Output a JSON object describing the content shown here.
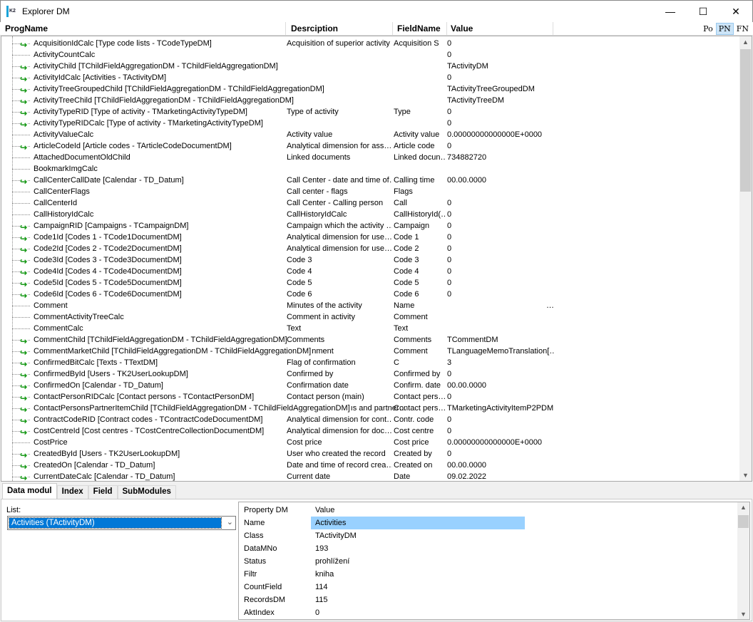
{
  "window": {
    "title": "Explorer DM",
    "minimize": "—",
    "maximize": "☐",
    "close": "✕"
  },
  "columns": {
    "progname": "ProgName",
    "description": "Desrciption",
    "fieldname": "FieldName",
    "value": "Value"
  },
  "view_modes": [
    {
      "label": "Po",
      "active": false
    },
    {
      "label": "PN",
      "active": true
    },
    {
      "label": "FN",
      "active": false
    }
  ],
  "rows": [
    {
      "prog": "AcquisitionIdCalc [Type code lists - TCodeTypeDM]",
      "desc": "Acquisition of superior activity",
      "field": "Acquisition S",
      "value": "0",
      "link": true
    },
    {
      "prog": "ActivityCountCalc",
      "desc": "",
      "field": "",
      "value": "0",
      "link": false
    },
    {
      "prog": "ActivityChild [TChildFieldAggregationDM - TChildFieldAggregationDM]",
      "desc": "",
      "field": "",
      "value": "TActivityDM",
      "link": true
    },
    {
      "prog": "ActivityIdCalc [Activities - TActivityDM]",
      "desc": "",
      "field": "",
      "value": "0",
      "link": true
    },
    {
      "prog": "ActivityTreeGroupedChild [TChildFieldAggregationDM - TChildFieldAggregationDM]",
      "desc": "",
      "field": "",
      "value": "TActivityTreeGroupedDM",
      "link": true
    },
    {
      "prog": "ActivityTreeChild [TChildFieldAggregationDM - TChildFieldAggregationDM]",
      "desc": "",
      "field": "",
      "value": "TActivityTreeDM",
      "link": true
    },
    {
      "prog": "ActivityTypeRID [Type of activity - TMarketingActivityTypeDM]",
      "desc": "Type of activity",
      "field": "Type",
      "value": "0",
      "link": true
    },
    {
      "prog": "ActivityTypeRIDCalc [Type of activity - TMarketingActivityTypeDM]",
      "desc": "",
      "field": "",
      "value": "0",
      "link": true
    },
    {
      "prog": "ActivityValueCalc",
      "desc": "Activity value",
      "field": "Activity value",
      "value": " 0.00000000000000E+0000",
      "link": false
    },
    {
      "prog": "ArticleCodeId [Article codes - TArticleCodeDocumentDM]",
      "desc": "Analytical dimension for ass…",
      "field": "Article code",
      "value": "0",
      "link": true
    },
    {
      "prog": "AttachedDocumentOldChild",
      "desc": "Linked documents",
      "field": "Linked docun…",
      "value": "734882720",
      "link": false
    },
    {
      "prog": "BookmarkImgCalc",
      "desc": "",
      "field": "",
      "value": "",
      "link": false
    },
    {
      "prog": "CallCenterCallDate [Calendar - TD_Datum]",
      "desc": "Call Center - date and time of…",
      "field": "Calling time",
      "value": "00.00.0000",
      "link": true
    },
    {
      "prog": "CallCenterFlags",
      "desc": "Call center - flags",
      "field": "Flags",
      "value": "",
      "link": false
    },
    {
      "prog": "CallCenterId",
      "desc": "Call Center - Calling person",
      "field": "Call",
      "value": "0",
      "link": false
    },
    {
      "prog": "CallHistoryIdCalc",
      "desc": "CallHistoryIdCalc",
      "field": "CallHistoryId(…",
      "value": "0",
      "link": false
    },
    {
      "prog": "CampaignRID [Campaigns - TCampaignDM]",
      "desc": "Campaign which the activity …",
      "field": "Campaign",
      "value": "0",
      "link": true
    },
    {
      "prog": "Code1Id [Codes 1 - TCode1DocumentDM]",
      "desc": "Analytical dimension for use…",
      "field": "Code 1",
      "value": "0",
      "link": true
    },
    {
      "prog": "Code2Id [Codes 2 - TCode2DocumentDM]",
      "desc": "Analytical dimension for use…",
      "field": "Code 2",
      "value": "0",
      "link": true
    },
    {
      "prog": "Code3Id [Codes 3 - TCode3DocumentDM]",
      "desc": "Code 3",
      "field": "Code 3",
      "value": "0",
      "link": true
    },
    {
      "prog": "Code4Id [Codes 4 - TCode4DocumentDM]",
      "desc": "Code 4",
      "field": "Code 4",
      "value": "0",
      "link": true
    },
    {
      "prog": "Code5Id [Codes 5 - TCode5DocumentDM]",
      "desc": "Code 5",
      "field": "Code 5",
      "value": "0",
      "link": true
    },
    {
      "prog": "Code6Id [Codes 6 - TCode6DocumentDM]",
      "desc": "Code 6",
      "field": "Code 6",
      "value": "0",
      "link": true
    },
    {
      "prog": "Comment",
      "desc": "Minutes of the activity",
      "field": "Name",
      "value": "…",
      "link": false
    },
    {
      "prog": "CommentActivityTreeCalc",
      "desc": "Comment in activity",
      "field": "Comment",
      "value": "",
      "link": false
    },
    {
      "prog": "CommentCalc",
      "desc": "Text",
      "field": "Text",
      "value": "",
      "link": false
    },
    {
      "prog": "CommentChild [TChildFieldAggregationDM - TChildFieldAggregationDM]",
      "desc": "Comments",
      "field": "Comments",
      "value": "TCommentDM",
      "link": true
    },
    {
      "prog": "CommentMarketChild [TChildFieldAggregationDM - TChildFieldAggregationDM]",
      "desc": "nment",
      "field": "Comment",
      "value": "TLanguageMemoTranslation[…",
      "link": true,
      "overflow": true
    },
    {
      "prog": "ConfirmedBitCalc [Texts - TTextDM]",
      "desc": "Flag of confirmation",
      "field": "C",
      "value": "3",
      "link": true
    },
    {
      "prog": "ConfirmedById [Users - TK2UserLookupDM]",
      "desc": "Confirmed by",
      "field": "Confirmed by",
      "value": "0",
      "link": true
    },
    {
      "prog": "ConfirmedOn [Calendar - TD_Datum]",
      "desc": "Confirmation date",
      "field": "Confirm. date",
      "value": "00.00.0000",
      "link": true
    },
    {
      "prog": "ContactPersonRIDCalc [Contact persons - TContactPersonDM]",
      "desc": "Contact person (main)",
      "field": "Contact pers…",
      "value": "0",
      "link": true
    },
    {
      "prog": "ContactPersonsPartnerItemChild [TChildFieldAggregationDM - TChildFieldAggregationDM]",
      "desc": "ıs and partner…",
      "field": "Contact pers…",
      "value": "TMarketingActivityItemP2PDM",
      "link": true,
      "overflow": true
    },
    {
      "prog": "ContractCodeRID [Contract codes - TContractCodeDocumentDM]",
      "desc": "Analytical dimension for cont…",
      "field": "Contr. code",
      "value": "0",
      "link": true
    },
    {
      "prog": "CostCentreId [Cost centres - TCostCentreCollectionDocumentDM]",
      "desc": "Analytical dimension for doc…",
      "field": "Cost centre",
      "value": "0",
      "link": true
    },
    {
      "prog": "CostPrice",
      "desc": "Cost price",
      "field": "Cost price",
      "value": " 0.00000000000000E+0000",
      "link": false
    },
    {
      "prog": "CreatedById [Users - TK2UserLookupDM]",
      "desc": "User who created the record",
      "field": "Created by",
      "value": "0",
      "link": true
    },
    {
      "prog": "CreatedOn [Calendar - TD_Datum]",
      "desc": "Date and time of record crea…",
      "field": "Created on",
      "value": "00.00.0000",
      "link": true
    },
    {
      "prog": "CurrentDateCalc [Calendar - TD_Datum]",
      "desc": "Current date",
      "field": "Date",
      "value": "09.02.2022",
      "link": true
    }
  ],
  "tabs": [
    {
      "label": "Data modul",
      "active": true
    },
    {
      "label": "Index",
      "active": false
    },
    {
      "label": "Field",
      "active": false
    },
    {
      "label": "SubModules",
      "active": false
    }
  ],
  "list": {
    "label": "List:",
    "selected": "Activities (TActivityDM)"
  },
  "properties": {
    "header_key": "Property DM",
    "header_value": "Value",
    "items": [
      {
        "key": "Name",
        "value": "Activities",
        "selected": true
      },
      {
        "key": "Class",
        "value": "TActivityDM"
      },
      {
        "key": "DataMNo",
        "value": "193"
      },
      {
        "key": "Status",
        "value": "prohlížení"
      },
      {
        "key": "Filtr",
        "value": "kniha"
      },
      {
        "key": "CountField",
        "value": "114"
      },
      {
        "key": "RecordsDM",
        "value": "115"
      },
      {
        "key": "AktIndex",
        "value": "0"
      }
    ]
  },
  "colors": {
    "link_arrow": "#1a9a1a",
    "selection": "#0078d7",
    "property_highlight": "#99d1ff"
  }
}
